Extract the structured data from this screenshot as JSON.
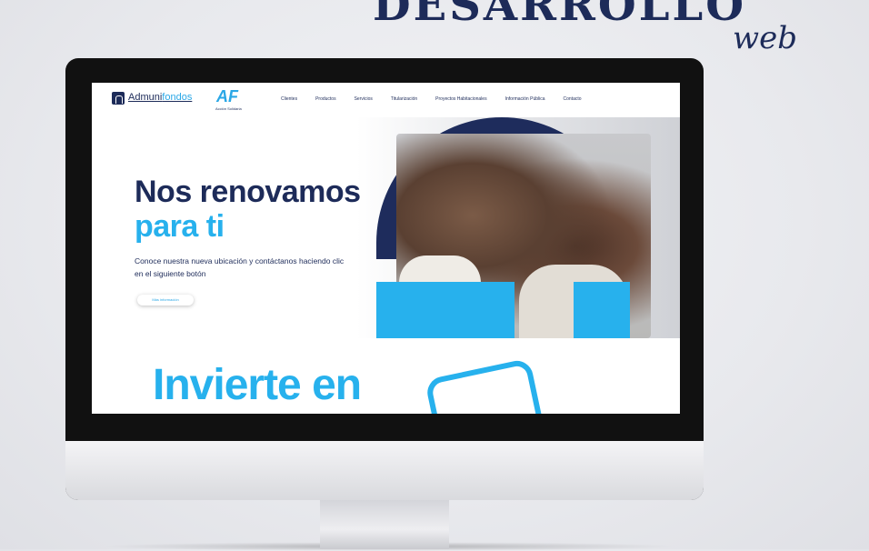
{
  "banner": {
    "headline": "DESARROLLO",
    "script": "web"
  },
  "website": {
    "logo_left": "Admuni",
    "logo_right": "fondos",
    "partner_logo": "AF",
    "partner_sub": "Acción Solidaria",
    "nav": [
      "Clientes",
      "Productos",
      "Servicios",
      "Titularización",
      "Proyectos Habitacionales",
      "Información Pública",
      "Contacto"
    ],
    "hero": {
      "title_line1": "Nos renovamos",
      "title_line2": "para ti",
      "description": "Conoce nuestra nueva ubicación y contáctanos haciendo clic en el siguiente botón",
      "button": "Más información"
    },
    "section2": {
      "title": "Invierte en"
    }
  },
  "colors": {
    "navy": "#1d2b59",
    "accent": "#27b1ed"
  }
}
